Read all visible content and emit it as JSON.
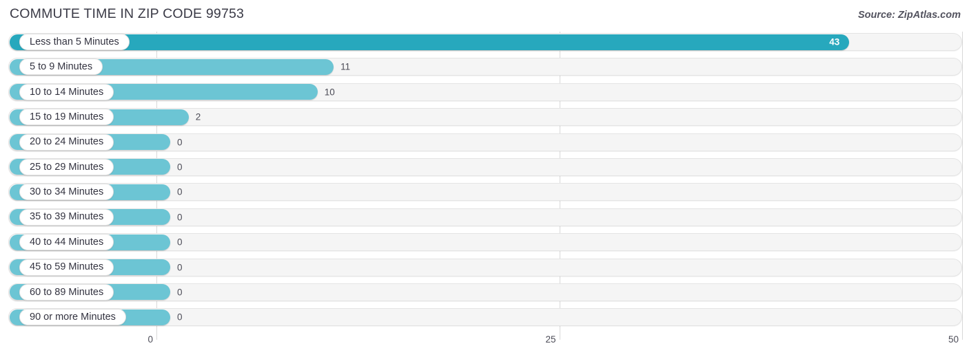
{
  "header": {
    "title": "COMMUTE TIME IN ZIP CODE 99753",
    "source": "Source: ZipAtlas.com"
  },
  "colors": {
    "bar_primary": "#27a8bd",
    "bar_secondary": "#6cc5d4",
    "track": "#f5f5f5",
    "gridline": "#d8d8d8",
    "text": "#4c4c57"
  },
  "chart_data": {
    "type": "bar",
    "orientation": "horizontal",
    "title": "COMMUTE TIME IN ZIP CODE 99753",
    "xlabel": "",
    "ylabel": "",
    "xlim": [
      0,
      50
    ],
    "grid": true,
    "legend": false,
    "source": "Source: ZipAtlas.com",
    "axis_ticks": [
      "0",
      "25",
      "50"
    ],
    "axis_tick_values": [
      0,
      25,
      50
    ],
    "categories": [
      "Less than 5 Minutes",
      "5 to 9 Minutes",
      "10 to 14 Minutes",
      "15 to 19 Minutes",
      "20 to 24 Minutes",
      "25 to 29 Minutes",
      "30 to 34 Minutes",
      "35 to 39 Minutes",
      "40 to 44 Minutes",
      "45 to 59 Minutes",
      "60 to 89 Minutes",
      "90 or more Minutes"
    ],
    "values": [
      43,
      11,
      10,
      2,
      0,
      0,
      0,
      0,
      0,
      0,
      0,
      0
    ],
    "value_labels": [
      "43",
      "11",
      "10",
      "2",
      "0",
      "0",
      "0",
      "0",
      "0",
      "0",
      "0",
      "0"
    ]
  },
  "rows": [
    {
      "label": "Less than 5 Minutes",
      "value": 43,
      "value_label": "43",
      "highlight": true
    },
    {
      "label": "5 to 9 Minutes",
      "value": 11,
      "value_label": "11",
      "highlight": false
    },
    {
      "label": "10 to 14 Minutes",
      "value": 10,
      "value_label": "10",
      "highlight": false
    },
    {
      "label": "15 to 19 Minutes",
      "value": 2,
      "value_label": "2",
      "highlight": false
    },
    {
      "label": "20 to 24 Minutes",
      "value": 0,
      "value_label": "0",
      "highlight": false
    },
    {
      "label": "25 to 29 Minutes",
      "value": 0,
      "value_label": "0",
      "highlight": false
    },
    {
      "label": "30 to 34 Minutes",
      "value": 0,
      "value_label": "0",
      "highlight": false
    },
    {
      "label": "35 to 39 Minutes",
      "value": 0,
      "value_label": "0",
      "highlight": false
    },
    {
      "label": "40 to 44 Minutes",
      "value": 0,
      "value_label": "0",
      "highlight": false
    },
    {
      "label": "45 to 59 Minutes",
      "value": 0,
      "value_label": "0",
      "highlight": false
    },
    {
      "label": "60 to 89 Minutes",
      "value": 0,
      "value_label": "0",
      "highlight": false
    },
    {
      "label": "90 or more Minutes",
      "value": 0,
      "value_label": "0",
      "highlight": false
    }
  ]
}
